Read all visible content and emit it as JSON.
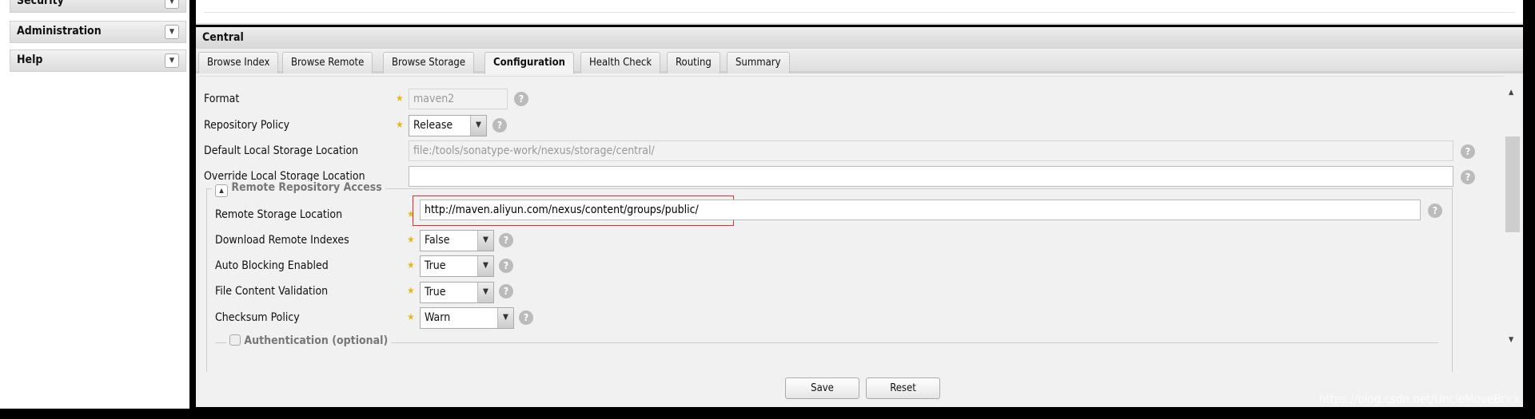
{
  "sidebar": {
    "items": [
      {
        "label": "Security"
      },
      {
        "label": "Administration"
      },
      {
        "label": "Help"
      }
    ]
  },
  "panel": {
    "title": "Central",
    "tabs": [
      {
        "label": "Browse Index"
      },
      {
        "label": "Browse Remote"
      },
      {
        "label": "Browse Storage"
      },
      {
        "label": "Configuration",
        "active": true
      },
      {
        "label": "Health Check"
      },
      {
        "label": "Routing"
      },
      {
        "label": "Summary"
      }
    ]
  },
  "form": {
    "format": {
      "label": "Format",
      "value": "maven2"
    },
    "repository_policy": {
      "label": "Repository Policy",
      "value": "Release"
    },
    "default_local": {
      "label": "Default Local Storage Location",
      "value": "file:/tools/sonatype-work/nexus/storage/central/"
    },
    "override_local": {
      "label": "Override Local Storage Location",
      "value": ""
    },
    "remote_section": {
      "legend": "Remote Repository Access",
      "remote_storage": {
        "label": "Remote Storage Location",
        "value": "http://maven.aliyun.com/nexus/content/groups/public/"
      },
      "download_indexes": {
        "label": "Download Remote Indexes",
        "value": "False"
      },
      "auto_blocking": {
        "label": "Auto Blocking Enabled",
        "value": "True"
      },
      "file_validation": {
        "label": "File Content Validation",
        "value": "True"
      },
      "checksum_policy": {
        "label": "Checksum Policy",
        "value": "Warn"
      }
    },
    "auth_section": {
      "legend": "Authentication (optional)",
      "checked": false
    }
  },
  "buttons": {
    "save": "Save",
    "reset": "Reset"
  },
  "watermark": "https://blog.csdn.net/UncleMoveBrick",
  "colors": {
    "highlight": "#e03030",
    "star": "#e8b820"
  }
}
